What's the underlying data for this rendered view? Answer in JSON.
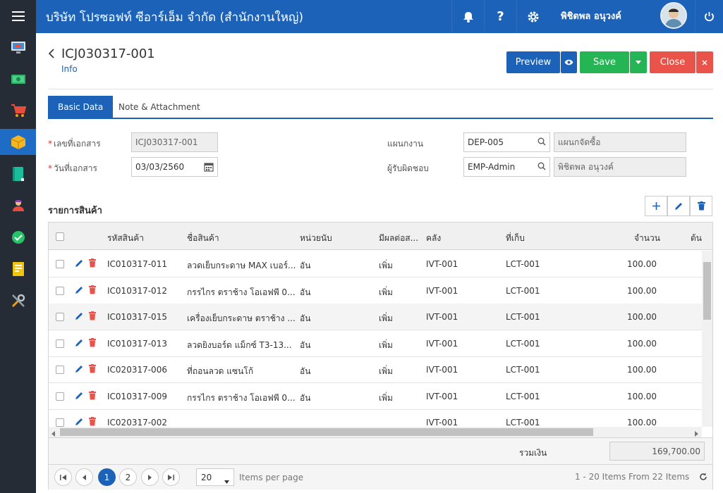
{
  "header": {
    "title": "บริษัท โปรซอฟท์ ซีอาร์เอ็ม จำกัด (สำนักงานใหญ่)",
    "user_name": "พิชิตพล อนุวงค์"
  },
  "sidebar": {
    "items": [
      {
        "icon": "monitor-icon"
      },
      {
        "icon": "money-icon"
      },
      {
        "icon": "cart-icon"
      },
      {
        "icon": "box-icon",
        "active": true
      },
      {
        "icon": "book-icon"
      },
      {
        "icon": "people-icon"
      },
      {
        "icon": "check-circle-icon"
      },
      {
        "icon": "report-icon"
      },
      {
        "icon": "tools-icon"
      }
    ]
  },
  "page": {
    "doc_id": "ICJ030317-001",
    "subtitle": "Info"
  },
  "actions": {
    "preview": "Preview",
    "save": "Save",
    "close": "Close"
  },
  "tabs": [
    "Basic Data",
    "Note & Attachment"
  ],
  "form": {
    "doc_no_label": "เลขที่เอกสาร",
    "doc_no_value": "ICJ030317-001",
    "doc_date_label": "วันที่เอกสาร",
    "doc_date_value": "03/03/2560",
    "dept_label": "แผนกงาน",
    "dept_code": "DEP-005",
    "dept_name": "แผนกจัดซื้อ",
    "owner_label": "ผู้รับผิดชอบ",
    "owner_code": "EMP-Admin",
    "owner_name": "พิชิตพล อนุวงค์"
  },
  "items_section": {
    "title": "รายการสินค้า"
  },
  "grid": {
    "columns": [
      "รหัสสินค้า",
      "ชื่อสินค้า",
      "หน่วยนับ",
      "มีผลต่อส...",
      "คลัง",
      "ที่เก็บ",
      "จำนวน",
      "ต้น"
    ],
    "rows": [
      {
        "code": "IC010317-011",
        "name": "ลวดเย็บกระดาษ MAX เบอร์...",
        "unit": "อัน",
        "effect": "เพิ่ม",
        "warehouse": "IVT-001",
        "location": "LCT-001",
        "qty": "100.00"
      },
      {
        "code": "IC010317-012",
        "name": "กรรไกร ตราช้าง โอเอฟพี 0...",
        "unit": "อัน",
        "effect": "เพิ่ม",
        "warehouse": "IVT-001",
        "location": "LCT-001",
        "qty": "100.00"
      },
      {
        "code": "IC010317-015",
        "name": "เครื่องเย็บกระดาษ ตราช้าง ...",
        "unit": "อัน",
        "effect": "เพิ่ม",
        "warehouse": "IVT-001",
        "location": "LCT-001",
        "qty": "100.00"
      },
      {
        "code": "IC010317-013",
        "name": "ลวดยิงบอร์ด แม็กซ์ T3-13...",
        "unit": "อัน",
        "effect": "เพิ่ม",
        "warehouse": "IVT-001",
        "location": "LCT-001",
        "qty": "100.00"
      },
      {
        "code": "IC020317-006",
        "name": "ที่ถอนลวด แซนโก้",
        "unit": "อัน",
        "effect": "เพิ่ม",
        "warehouse": "IVT-001",
        "location": "LCT-001",
        "qty": "100.00"
      },
      {
        "code": "IC010317-009",
        "name": "กรรไกร ตราช้าง โอเอฟพี 0...",
        "unit": "อัน",
        "effect": "เพิ่ม",
        "warehouse": "IVT-001",
        "location": "LCT-001",
        "qty": "100.00"
      },
      {
        "code": "IC020317-002",
        "name": "",
        "unit": "",
        "effect": "",
        "warehouse": "IVT-001",
        "location": "LCT-001",
        "qty": "100.00"
      }
    ],
    "total_label": "รวมเงิน",
    "total_value": "169,700.00"
  },
  "pager": {
    "pages": [
      "1",
      "2"
    ],
    "page_size": "20",
    "items_per_page_label": "Items per page",
    "summary": "1 - 20 Items From 22 Items"
  },
  "colors": {
    "primary": "#1c62b9",
    "success": "#26b554",
    "danger": "#e9534a",
    "sidebar": "#262c36"
  }
}
